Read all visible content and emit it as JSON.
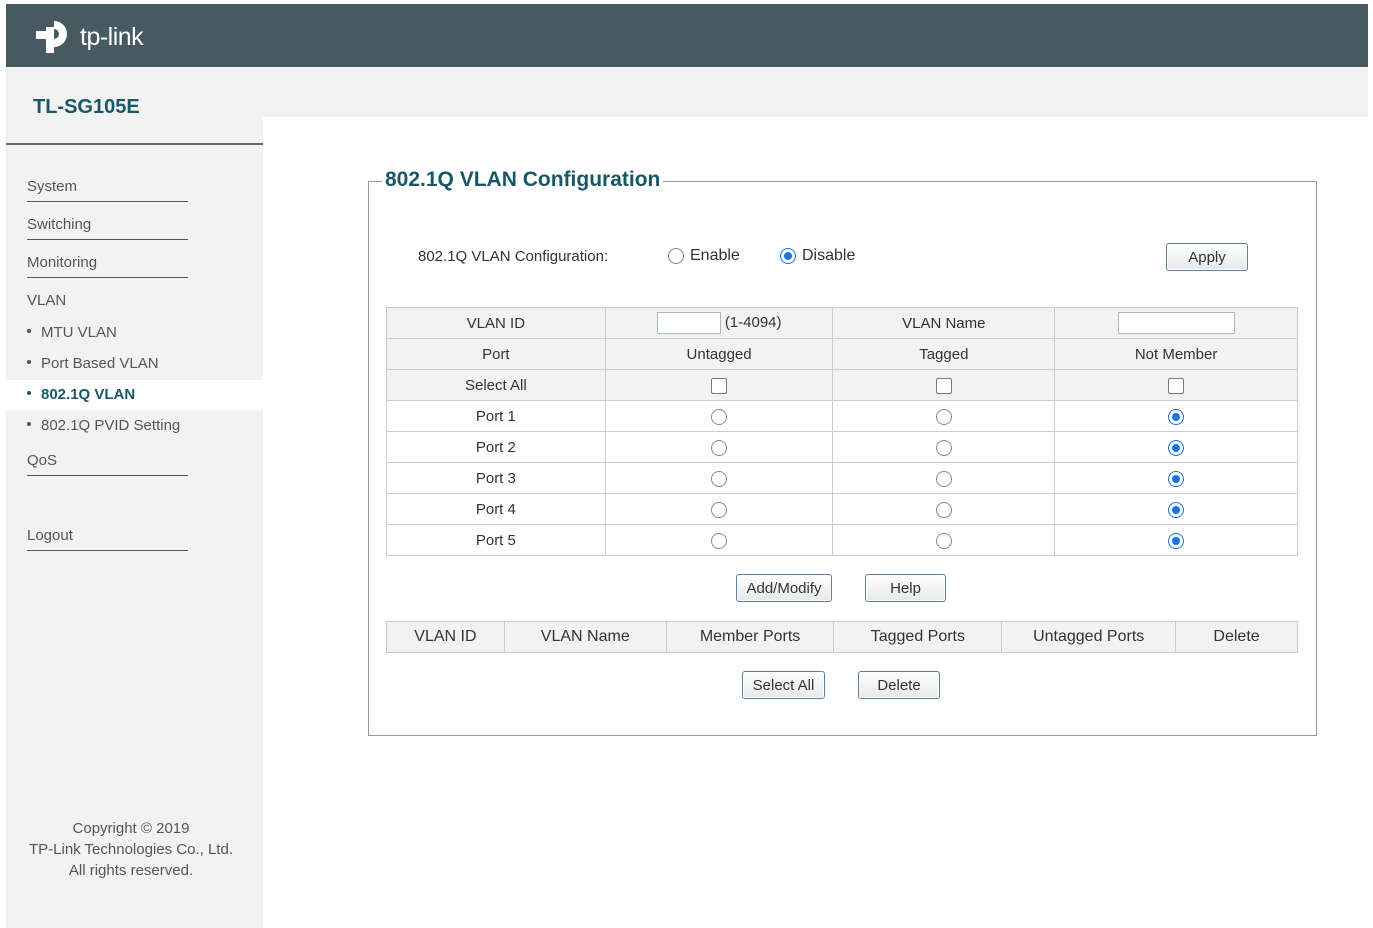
{
  "header": {
    "logo_text": "tp-link",
    "brand_color": "#475a62",
    "accent_color": "#1a5868"
  },
  "model": "TL-SG105E",
  "sidebar": {
    "items": [
      {
        "label": "System"
      },
      {
        "label": "Switching"
      },
      {
        "label": "Monitoring"
      },
      {
        "label": "VLAN"
      },
      {
        "label": "QoS"
      },
      {
        "label": "Logout"
      }
    ],
    "vlan_subitems": [
      {
        "label": "MTU VLAN"
      },
      {
        "label": "Port Based VLAN"
      },
      {
        "label": "802.1Q VLAN",
        "active": true
      },
      {
        "label": "802.1Q PVID Setting"
      }
    ],
    "copyright": [
      "Copyright © 2019",
      "TP-Link Technologies Co., Ltd.",
      "All rights reserved."
    ]
  },
  "main": {
    "section_title": "802.1Q VLAN Configuration",
    "config_label": "802.1Q VLAN Configuration:",
    "enable_label": "Enable",
    "disable_label": "Disable",
    "selected_mode": "Disable",
    "apply_label": "Apply",
    "table": {
      "vlan_id_label": "VLAN ID",
      "vlan_id_value": "",
      "vlan_id_range": "(1-4094)",
      "vlan_name_label": "VLAN Name",
      "vlan_name_value": "",
      "columns": [
        "Port",
        "Untagged",
        "Tagged",
        "Not Member"
      ],
      "select_all_label": "Select All",
      "ports": [
        {
          "name": "Port 1",
          "membership": "Not Member"
        },
        {
          "name": "Port 2",
          "membership": "Not Member"
        },
        {
          "name": "Port 3",
          "membership": "Not Member"
        },
        {
          "name": "Port 4",
          "membership": "Not Member"
        },
        {
          "name": "Port 5",
          "membership": "Not Member"
        }
      ]
    },
    "add_modify_label": "Add/Modify",
    "help_label": "Help",
    "list_columns": [
      "VLAN ID",
      "VLAN Name",
      "Member Ports",
      "Tagged Ports",
      "Untagged Ports",
      "Delete"
    ],
    "select_all_button": "Select All",
    "delete_button": "Delete"
  }
}
